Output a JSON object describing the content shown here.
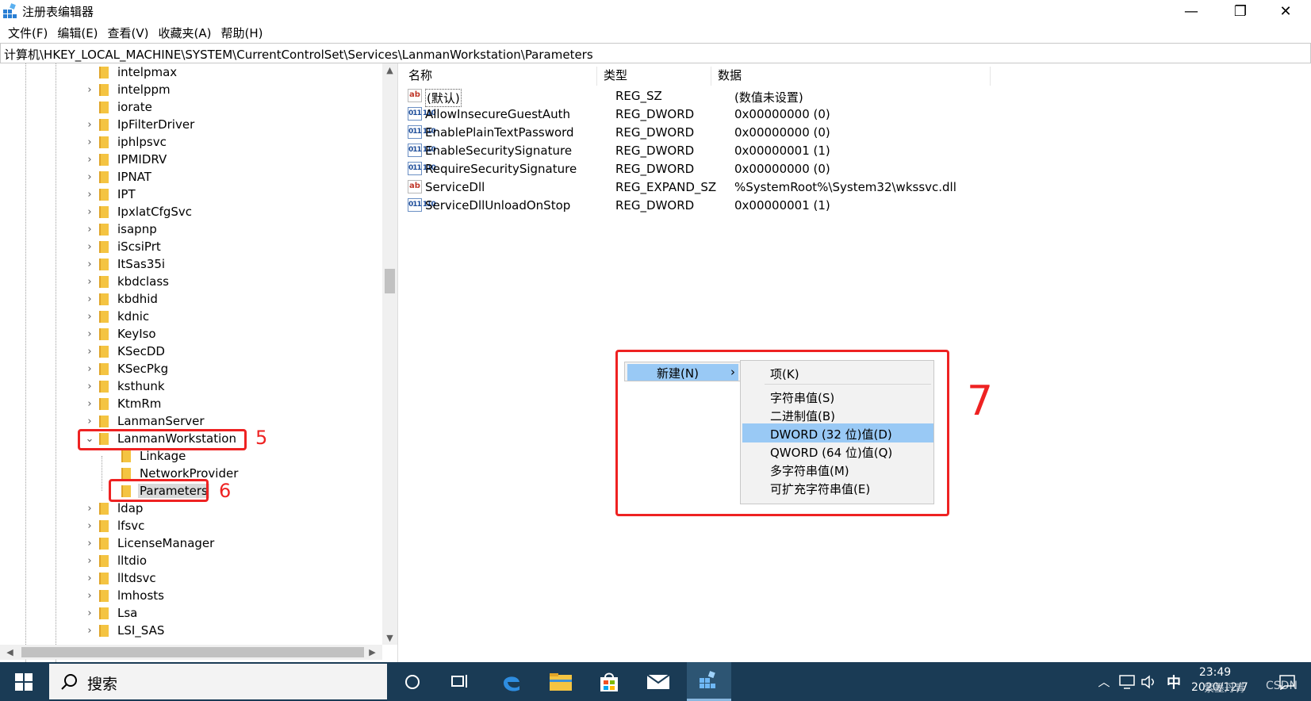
{
  "window": {
    "title": "注册表编辑器",
    "controls": {
      "minimize": "—",
      "maximize": "❐",
      "close": "✕"
    }
  },
  "menu": [
    "文件(F)",
    "编辑(E)",
    "查看(V)",
    "收藏夹(A)",
    "帮助(H)"
  ],
  "address": "计算机\\HKEY_LOCAL_MACHINE\\SYSTEM\\CurrentControlSet\\Services\\LanmanWorkstation\\Parameters",
  "tree": {
    "items": [
      {
        "label": "intelpmax",
        "expandable": false
      },
      {
        "label": "intelppm",
        "expandable": true
      },
      {
        "label": "iorate",
        "expandable": false
      },
      {
        "label": "IpFilterDriver",
        "expandable": true
      },
      {
        "label": "iphlpsvc",
        "expandable": true
      },
      {
        "label": "IPMIDRV",
        "expandable": true
      },
      {
        "label": "IPNAT",
        "expandable": true
      },
      {
        "label": "IPT",
        "expandable": true
      },
      {
        "label": "IpxlatCfgSvc",
        "expandable": true
      },
      {
        "label": "isapnp",
        "expandable": true
      },
      {
        "label": "iScsiPrt",
        "expandable": true
      },
      {
        "label": "ItSas35i",
        "expandable": true
      },
      {
        "label": "kbdclass",
        "expandable": true
      },
      {
        "label": "kbdhid",
        "expandable": true
      },
      {
        "label": "kdnic",
        "expandable": true
      },
      {
        "label": "KeyIso",
        "expandable": true
      },
      {
        "label": "KSecDD",
        "expandable": true
      },
      {
        "label": "KSecPkg",
        "expandable": true
      },
      {
        "label": "ksthunk",
        "expandable": true
      },
      {
        "label": "KtmRm",
        "expandable": true
      },
      {
        "label": "LanmanServer",
        "expandable": true
      },
      {
        "label": "LanmanWorkstation",
        "expanded": true
      },
      {
        "label": "Linkage",
        "child": true
      },
      {
        "label": "NetworkProvider",
        "child": true
      },
      {
        "label": "Parameters",
        "child": true,
        "selected": true
      },
      {
        "label": "ldap",
        "expandable": true
      },
      {
        "label": "lfsvc",
        "expandable": true
      },
      {
        "label": "LicenseManager",
        "expandable": true
      },
      {
        "label": "lltdio",
        "expandable": true
      },
      {
        "label": "lltdsvc",
        "expandable": true
      },
      {
        "label": "lmhosts",
        "expandable": true
      },
      {
        "label": "Lsa",
        "expandable": true
      },
      {
        "label": "LSI_SAS",
        "expandable": true
      }
    ]
  },
  "values": {
    "columns": {
      "name": "名称",
      "type": "类型",
      "data": "数据"
    },
    "rows": [
      {
        "icon": "string-value-icon",
        "icon_text": "ab",
        "name": "(默认)",
        "type": "REG_SZ",
        "data": "(数值未设置)"
      },
      {
        "icon": "binary-value-icon",
        "icon_text": "011\n110",
        "name": "AllowInsecureGuestAuth",
        "type": "REG_DWORD",
        "data": "0x00000000 (0)"
      },
      {
        "icon": "binary-value-icon",
        "icon_text": "011\n110",
        "name": "EnablePlainTextPassword",
        "type": "REG_DWORD",
        "data": "0x00000000 (0)"
      },
      {
        "icon": "binary-value-icon",
        "icon_text": "011\n110",
        "name": "EnableSecuritySignature",
        "type": "REG_DWORD",
        "data": "0x00000001 (1)"
      },
      {
        "icon": "binary-value-icon",
        "icon_text": "011\n110",
        "name": "RequireSecuritySignature",
        "type": "REG_DWORD",
        "data": "0x00000000 (0)"
      },
      {
        "icon": "string-value-icon",
        "icon_text": "ab",
        "name": "ServiceDll",
        "type": "REG_EXPAND_SZ",
        "data": "%SystemRoot%\\System32\\wkssvc.dll"
      },
      {
        "icon": "binary-value-icon",
        "icon_text": "011\n110",
        "name": "ServiceDllUnloadOnStop",
        "type": "REG_DWORD",
        "data": "0x00000001 (1)"
      }
    ]
  },
  "context_menu": {
    "main_item": "新建(N)",
    "arrow": "›",
    "submenu": [
      "项(K)",
      "字符串值(S)",
      "二进制值(B)",
      "DWORD (32 位)值(D)",
      "QWORD (64 位)值(Q)",
      "多字符串值(M)",
      "可扩充字符串值(E)"
    ]
  },
  "annotations": {
    "step5": "5",
    "step6": "6",
    "step7": "7",
    "color": "#ee2222"
  },
  "taskbar": {
    "search_label": "搜索",
    "ime": "中",
    "time": "23:49",
    "date": "2020/12/7",
    "watermark": "紫墨丹青",
    "watermark2": "CSDN",
    "background": "#1a3b55"
  }
}
